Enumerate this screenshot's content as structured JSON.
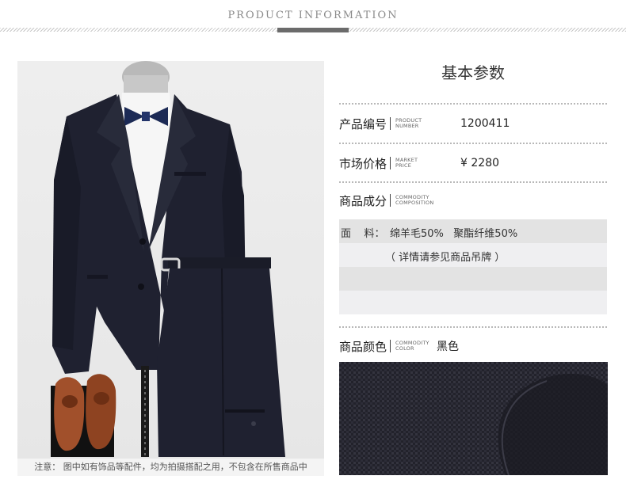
{
  "header": {
    "title": "PRODUCT INFORMATION"
  },
  "photo": {
    "note": "注意：  图中如有饰品等配件，均为拍摄搭配之用，不包含在所售商品中"
  },
  "params": {
    "title": "基本参数",
    "product_number": {
      "cn": "产品编号",
      "en1": "PRODUCT",
      "en2": "NUMBER",
      "value": "1200411"
    },
    "market_price": {
      "cn": "市场价格",
      "en1": "MARKET",
      "en2": "PRICE",
      "value": "¥  2280"
    },
    "composition": {
      "cn": "商品成分",
      "en1": "COMMODITY",
      "en2": "COMPOSITION"
    },
    "material": {
      "label": "面    料：",
      "value": "绵羊毛50%   聚酯纤维50%",
      "note": "（ 详情请参见商品吊牌 ）"
    },
    "color": {
      "cn": "商品颜色",
      "en1": "COMMODITY",
      "en2": "COLOR",
      "value": "黑色"
    }
  },
  "colors": {
    "suit": "#1f2130",
    "accent": "#6b6b6b",
    "fabric": "#23232c"
  },
  "icons": [
    "suit-image",
    "shoes-image",
    "fabric-swatch"
  ]
}
